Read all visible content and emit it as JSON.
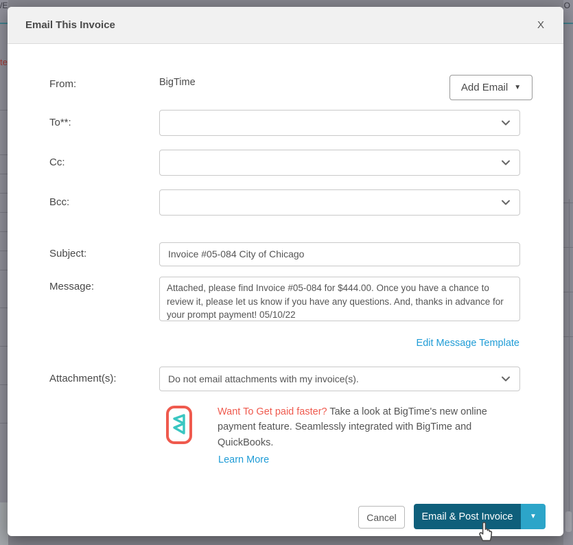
{
  "background": {
    "top_left_text": "/E",
    "top_right_text": "O",
    "left_red_text": "te"
  },
  "modal": {
    "title": "Email This Invoice",
    "close_label": "X",
    "fields": {
      "from": {
        "label": "From:",
        "value": "BigTime"
      },
      "add_email_label": "Add Email",
      "to": {
        "label": "To**:",
        "value": ""
      },
      "cc": {
        "label": "Cc:",
        "value": ""
      },
      "bcc": {
        "label": "Bcc:",
        "value": ""
      },
      "subject": {
        "label": "Subject:",
        "value": "Invoice #05-084 City of Chicago"
      },
      "message": {
        "label": "Message:",
        "value": "Attached, please find Invoice #05-084 for $444.00.  Once you have a chance to review it, please let us know if you have any questions.  And, thanks in advance for your prompt payment! 05/10/22"
      },
      "edit_template_link": "Edit Message Template",
      "attachments": {
        "label": "Attachment(s):",
        "value": "Do not email attachments with my invoice(s)."
      }
    },
    "promo": {
      "highlight": "Want To Get paid faster?",
      "body": " Take a look at BigTime's new online payment feature. Seamlessly integrated with BigTime and QuickBooks.",
      "learn_more": "Learn More"
    },
    "footer": {
      "cancel_label": "Cancel",
      "primary_label": "Email & Post Invoice"
    },
    "colors": {
      "primary_dark_teal": "#0f5f7b",
      "primary_cyan": "#2ca5c9",
      "link_blue": "#1f9cd6",
      "coral": "#ef5a4e",
      "logo_teal": "#3ac6c1"
    }
  }
}
